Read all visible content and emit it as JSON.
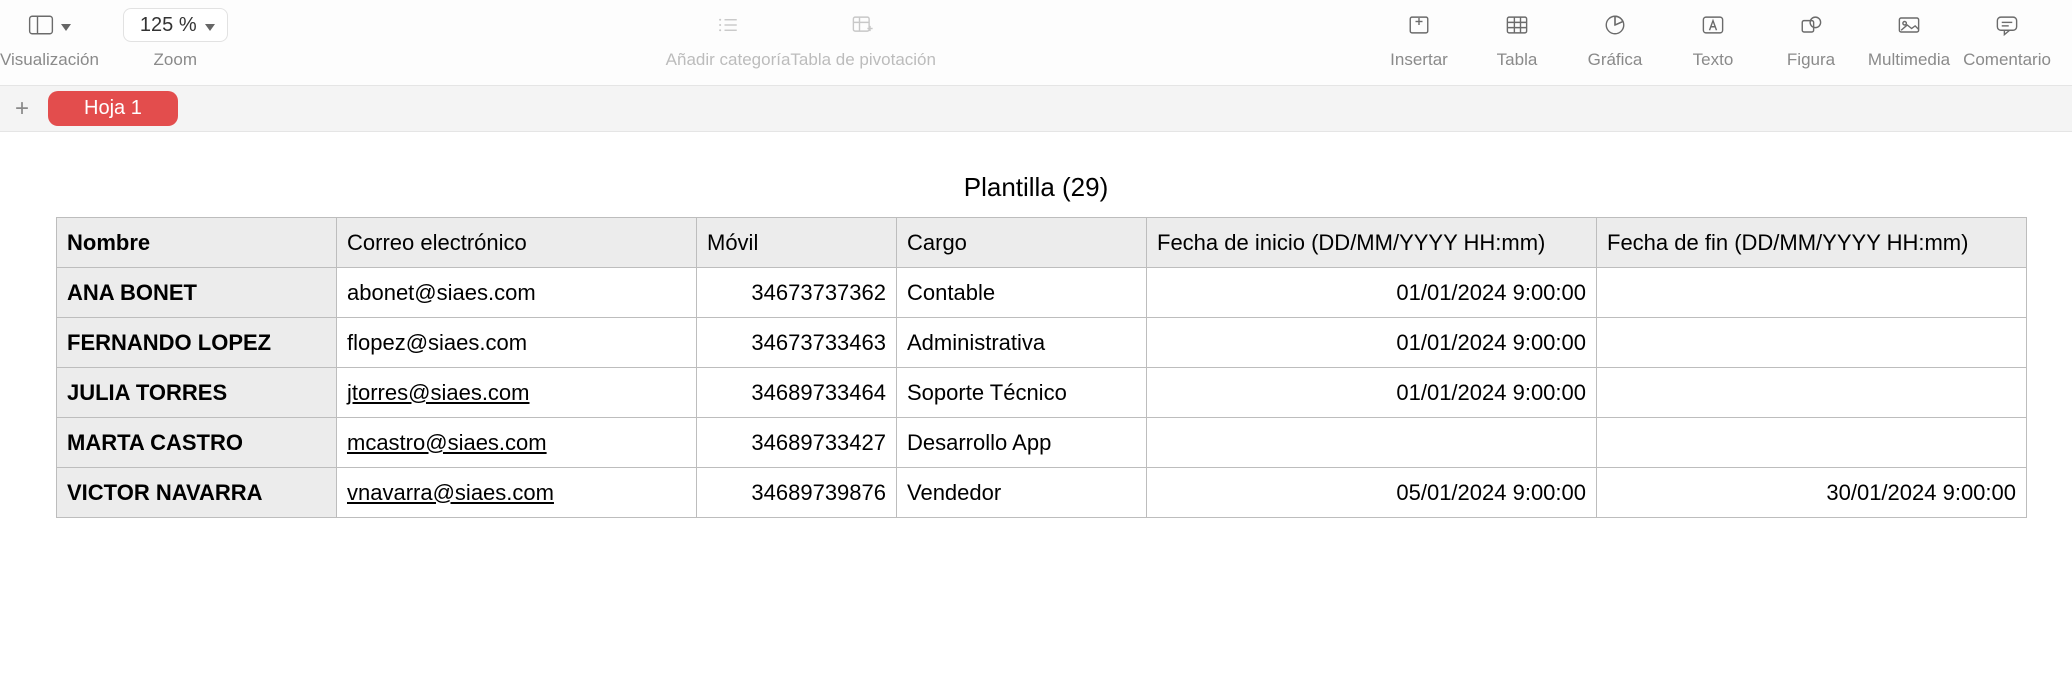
{
  "toolbar": {
    "visualizacion_label": "Visualización",
    "zoom_label": "Zoom",
    "zoom_value": "125 %",
    "anadir_categoria_label": "Añadir categoría",
    "tabla_pivotacion_label": "Tabla de pivotación",
    "insertar_label": "Insertar",
    "tabla_label": "Tabla",
    "grafica_label": "Gráfica",
    "texto_label": "Texto",
    "figura_label": "Figura",
    "multimedia_label": "Multimedia",
    "comentario_label": "Comentario"
  },
  "tabs": {
    "sheet1": "Hoja 1"
  },
  "table": {
    "title": "Plantilla (29)",
    "headers": {
      "nombre": "Nombre",
      "correo": "Correo electrónico",
      "movil": "Móvil",
      "cargo": "Cargo",
      "inicio": "Fecha de inicio (DD/MM/YYYY HH:mm)",
      "fin": "Fecha de fin (DD/MM/YYYY HH:mm)"
    },
    "rows": [
      {
        "nombre": "ANA BONET",
        "correo": "abonet@siaes.com",
        "correo_link": false,
        "movil": "34673737362",
        "cargo": "Contable",
        "inicio": "01/01/2024 9:00:00",
        "fin": ""
      },
      {
        "nombre": "FERNANDO LOPEZ",
        "correo": "flopez@siaes.com",
        "correo_link": false,
        "movil": "34673733463",
        "cargo": "Administrativa",
        "inicio": "01/01/2024 9:00:00",
        "fin": ""
      },
      {
        "nombre": "JULIA TORRES",
        "correo": "jtorres@siaes.com",
        "correo_link": true,
        "movil": "34689733464",
        "cargo": "Soporte Técnico",
        "inicio": "01/01/2024 9:00:00",
        "fin": ""
      },
      {
        "nombre": "MARTA CASTRO",
        "correo": "mcastro@siaes.com",
        "correo_link": true,
        "movil": "34689733427",
        "cargo": "Desarrollo App",
        "inicio": "",
        "fin": ""
      },
      {
        "nombre": "VICTOR NAVARRA",
        "correo": "vnavarra@siaes.com",
        "correo_link": true,
        "movil": "34689739876",
        "cargo": "Vendedor",
        "inicio": "05/01/2024 9:00:00",
        "fin": "30/01/2024 9:00:00"
      }
    ]
  }
}
